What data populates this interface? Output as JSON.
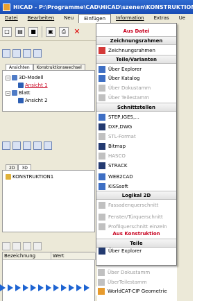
{
  "window": {
    "title": "HiCAD - P:\\Programme\\CAD\\HiCAD\\szenen\\KONSTRUKTION1.S"
  },
  "menubar": [
    {
      "label": "Datei"
    },
    {
      "label": "Bearbeiten"
    },
    {
      "label": "Neu"
    },
    {
      "label": "Einfügen",
      "active": true
    },
    {
      "label": "Information"
    },
    {
      "label": "Extras"
    },
    {
      "label": "Ue"
    }
  ],
  "left": {
    "tabs": [
      "Ansichten",
      "Konstruktionswechsel"
    ],
    "tree": {
      "root": "3D-Modell",
      "child1": "Ansicht 1",
      "root2": "Blatt",
      "child2": "Ansicht 2"
    },
    "tabs2": [
      "2D",
      "3D"
    ],
    "list2": [
      "KONSTRUKTION1"
    ],
    "props": {
      "col1": "Bezeichnung",
      "col2": "Wert"
    }
  },
  "dropdown": {
    "h_ausdatei": "Aus Datei",
    "h_zeichnungsrahmen": "Zeichnungsrahmen",
    "zeichnungsrahmen": "Zeichnungsrahmen",
    "h_teile_varianten": "Teile/Varianten",
    "ueber_explorer": "Über Explorer",
    "ueber_katalog": "Über Katalog",
    "ueber_dokustamm": "Über Dokustamm",
    "ueber_teilestamm": "Über Teilestamm",
    "h_schnittstellen": "Schnittstellen",
    "step": "STEP,IGES,...",
    "dxf": "DXF,DWG",
    "stl": "STL-Format",
    "bitmap": "Bitmap",
    "hasco": "HASCO",
    "strack": "STRACK",
    "web2cad": "WEB2CAD",
    "kisssoft": "KISSsoft",
    "h_logikal": "Logikal 2D",
    "fassade": "Fassadenquerschnitt",
    "fenster": "Fenster/Türquerschnitt",
    "profil": "Profilquerschnitt einzeln",
    "h_aus_konstruktion": "Aus Konstruktion",
    "h_teile": "Teile",
    "ueber_explorer2": "Über Explorer",
    "ueber_dokustamm2": "Über Dokustamm",
    "ueber_teilestamm2": "ÜberTeilestamm",
    "worldcat": "WorldCAT-CIP Geometrie"
  },
  "colors": {
    "accent_red": "#c8001e",
    "title_blue": "#1a4db5",
    "arrow_blue": "#1e64d2"
  }
}
